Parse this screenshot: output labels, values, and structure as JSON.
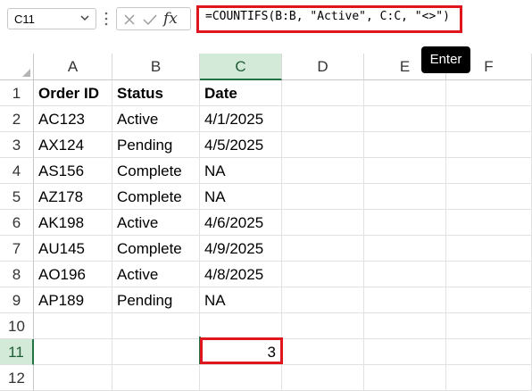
{
  "formula_bar": {
    "name_box": "C11",
    "fx_label": "fx",
    "formula": "=COUNTIFS(B:B, \"Active\", C:C, \"<>\")"
  },
  "tooltip": "Enter",
  "columns": [
    "A",
    "B",
    "C",
    "D",
    "E",
    "F"
  ],
  "rows": [
    "1",
    "2",
    "3",
    "4",
    "5",
    "6",
    "7",
    "8",
    "9",
    "10",
    "11",
    "12"
  ],
  "table": {
    "headers": [
      "Order ID",
      "Status",
      "Date"
    ],
    "data": [
      [
        "AC123",
        "Active",
        "4/1/2025"
      ],
      [
        "AX124",
        "Pending",
        "4/5/2025"
      ],
      [
        "AS156",
        "Complete",
        "NA"
      ],
      [
        "AZ178",
        "Complete",
        "NA"
      ],
      [
        "AK198",
        "Active",
        "4/6/2025"
      ],
      [
        "AU145",
        "Complete",
        "4/9/2025"
      ],
      [
        "AO196",
        "Active",
        "4/8/2025"
      ],
      [
        "AP189",
        "Pending",
        "NA"
      ]
    ]
  },
  "result": {
    "cell": "C11",
    "value": "3"
  },
  "colors": {
    "highlight": "#e0161e",
    "selection": "#217346",
    "header_selected_bg": "#d3ead9"
  }
}
